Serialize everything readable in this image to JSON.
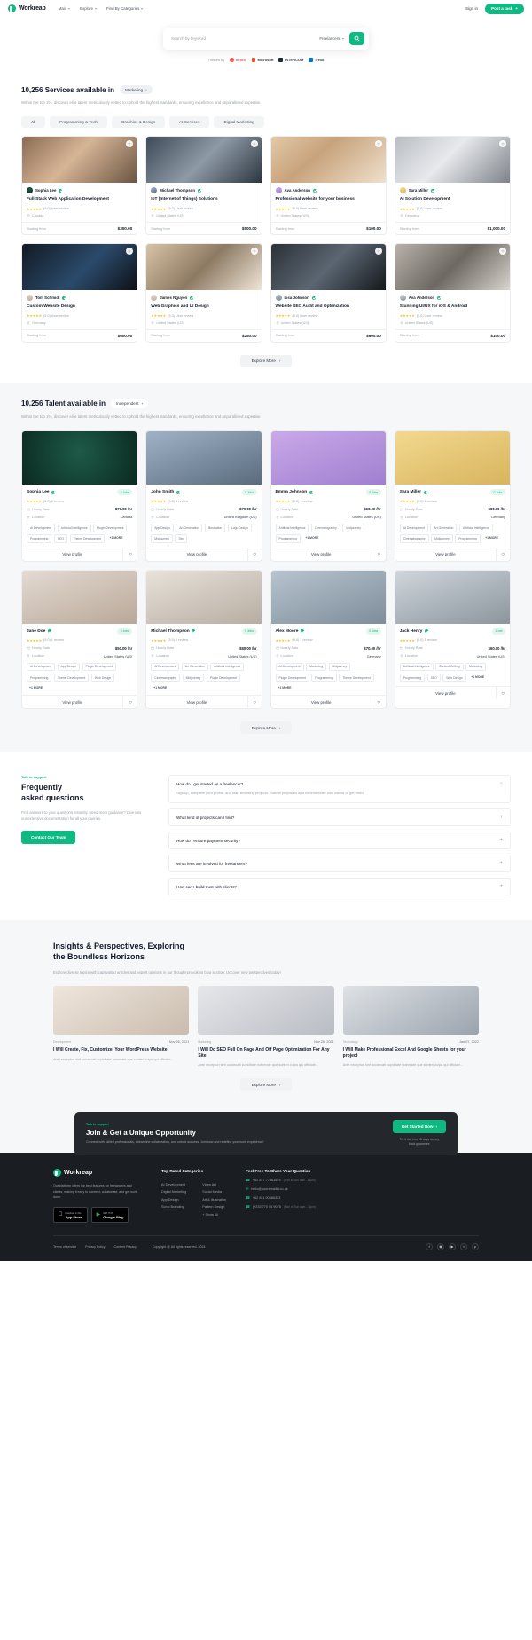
{
  "header": {
    "brand": "Workreap",
    "nav": [
      {
        "label": "Main",
        "caret": true
      },
      {
        "label": "Explore",
        "caret": true
      },
      {
        "label": "Find By Categories",
        "caret": true
      }
    ],
    "signin": "Sign in",
    "post_task": "Post a task",
    "post_task_icon": "plus-icon"
  },
  "hero": {
    "search_placeholder": "Search by keyword",
    "search_type": "Freelancers",
    "search_icon": "search-icon",
    "trusted_label": "Trusted by",
    "logos": [
      "airbnb",
      "Microsoft",
      "INTERCOM",
      "Trello"
    ]
  },
  "services": {
    "title": "10,256 Services available in",
    "tag": "Marketing",
    "subtitle": "Within the top 1%, discover elite talent meticulously vetted to uphold the highest standards, ensuring excellence and unparalleled expertise.",
    "tabs": [
      "All",
      "Programming & Tech",
      "Graphics & Design",
      "AI Services",
      "Digital Marketing"
    ],
    "active_tab": "All",
    "starting_from": "Starting from",
    "explore_more": "Explore More",
    "cards": [
      {
        "author": "Sophia Lee",
        "title": "Full-Stack Web Application Development",
        "rating": "5.00",
        "reviews": "(5.0) User review",
        "location": "Canada",
        "price": "$300.00",
        "img": "img-a",
        "avatar": "ph1"
      },
      {
        "author": "Michael Thompson",
        "title": "IoT (Internet of Things) Solutions",
        "rating": "5.00",
        "reviews": "(5.0) User review",
        "location": "United States (US)",
        "price": "$500.00",
        "img": "img-b",
        "avatar": "ph2"
      },
      {
        "author": "Ava Anderson",
        "title": "Professional website for your business",
        "rating": "5.00",
        "reviews": "(5.0) User review",
        "location": "United States (US)",
        "price": "$100.00",
        "img": "img-c",
        "avatar": "ph3"
      },
      {
        "author": "Sara Miller",
        "title": "AI Solution Development",
        "rating": "5.00",
        "reviews": "(5.0) User review",
        "location": "Germany",
        "price": "$1,000.00",
        "img": "img-d",
        "avatar": "ph4"
      },
      {
        "author": "Tom Schmidt",
        "title": "Custom Website Design",
        "rating": "5.00",
        "reviews": "(5.0) User review",
        "location": "Germany",
        "price": "$600.00",
        "img": "img-e",
        "avatar": "ph5"
      },
      {
        "author": "James Nguyen",
        "title": "Web Graphics and UI Design",
        "rating": "5.00",
        "reviews": "(5.0) User review",
        "location": "United States (US)",
        "price": "$250.00",
        "img": "img-f",
        "avatar": "ph6"
      },
      {
        "author": "Lisa Johnson",
        "title": "Website SEO Audit and Optimization",
        "rating": "5.00",
        "reviews": "(5.0) User review",
        "location": "United States (US)",
        "price": "$600.00",
        "img": "img-g",
        "avatar": "ph7"
      },
      {
        "author": "Ava Anderson",
        "title": "Stunning UI/UX for iOS & Android",
        "rating": "5.00",
        "reviews": "(5.0) User review",
        "location": "United States (US)",
        "price": "$100.00",
        "img": "img-h",
        "avatar": "ph8"
      }
    ]
  },
  "talent": {
    "title": "10,256 Talent available in",
    "tag": "Independent",
    "subtitle": "Within the top 1%, discover elite talent meticulously vetted to uphold the highest standards, ensuring excellence and unparalleled expertise.",
    "hourly_label": "Hourly Rate",
    "location_label": "Location",
    "view_profile": "View profile",
    "explore_more": "Explore More",
    "cards": [
      {
        "name": "Sophia Lee",
        "badge": "0 Jobs",
        "rating": "(5.0) 1 review",
        "rate": "$70.00 /hr",
        "location": "Canada",
        "img": "ph1",
        "tags": [
          "AI Development",
          "Artificial Intelligence",
          "Plugin Development",
          "Programming",
          "SEO",
          "Theme Development",
          "+1 MORE"
        ]
      },
      {
        "name": "John Smith",
        "badge": "0 Jobs",
        "rating": "(5.0) 1 review",
        "rate": "$70.00 /hr",
        "location": "United Kingdom (UK)",
        "img": "ph2",
        "tags": [
          "App Design",
          "Art Generation",
          "Illustration",
          "Logo Design",
          "Midjourney",
          "Seo"
        ]
      },
      {
        "name": "Emma Johnson",
        "badge": "0 Jobs",
        "rating": "(5.0) 1 review",
        "rate": "$60.00 /hr",
        "location": "United States (US)",
        "img": "ph3",
        "tags": [
          "Artificial Intelligence",
          "Cinematography",
          "Midjourney",
          "Programming",
          "+1 MORE"
        ]
      },
      {
        "name": "Sara Miller",
        "badge": "0 Jobs",
        "rating": "(5.0) 1 review",
        "rate": "$80.00 /hr",
        "location": "Germany",
        "img": "ph4",
        "tags": [
          "AI Development",
          "Art Generation",
          "Artificial Intelligence",
          "Cinematography",
          "Midjourney",
          "Programming",
          "+1 MORE"
        ]
      },
      {
        "name": "Jane Doe",
        "badge": "0 Jobs",
        "rating": "(5.0) 1 review",
        "rate": "$50.00 /hr",
        "location": "United States (US)",
        "img": "ph5",
        "tags": [
          "AI Development",
          "App Design",
          "Plugin Development",
          "Programming",
          "Theme Development",
          "Web Design",
          "+1 MORE"
        ]
      },
      {
        "name": "Michael Thompson",
        "badge": "0 Jobs",
        "rating": "(5.0) 1 review",
        "rate": "$80.00 /hr",
        "location": "United States (US)",
        "img": "ph6",
        "tags": [
          "AI Development",
          "Art Generation",
          "Artificial Intelligence",
          "Cinematography",
          "Midjourney",
          "Plugin Development",
          "+1 MORE"
        ]
      },
      {
        "name": "Alex Moore",
        "badge": "0 Jobs",
        "rating": "(5.0) 1 review",
        "rate": "$70.00 /hr",
        "location": "Germany",
        "img": "ph7",
        "tags": [
          "AI Development",
          "Marketing",
          "Midjourney",
          "Plugin Development",
          "Programming",
          "Theme Development",
          "+1 MORE"
        ]
      },
      {
        "name": "Jack Henry",
        "badge": "1 Job",
        "rating": "(5.0) 1 review",
        "rate": "$60.00 /hr",
        "location": "United States (US)",
        "img": "ph8",
        "tags": [
          "Artificial Intelligence",
          "Content Writing",
          "Marketing",
          "Programming",
          "SEO",
          "Web Design",
          "+1 MORE"
        ]
      }
    ]
  },
  "faq": {
    "kicker": "Talk to support",
    "heading_1": "Frequently",
    "heading_2": "asked questions",
    "paragraph": "Find answers to your questions instantly. Need more guidance? Dive into our extensive documentation for all your queries.",
    "button": "Contact Our Team",
    "items": [
      {
        "q": "How do I get started as a freelancer?",
        "a": "Sign up, complete your profile, and start browsing projects. Submit proposals and communicate with clients to get hired.",
        "open": true
      },
      {
        "q": "What kind of projects can I find?",
        "a": "",
        "open": false
      },
      {
        "q": "How do I ensure payment security?",
        "a": "",
        "open": false
      },
      {
        "q": "What fees are involved for freelancers?",
        "a": "",
        "open": false
      },
      {
        "q": "How can I build trust with clients?",
        "a": "",
        "open": false
      }
    ]
  },
  "blog": {
    "heading_1": "Insights & Perspectives, Exploring",
    "heading_2": "the Boundless Horizons",
    "paragraph": "Explore diverse topics with captivating articles and expert opinions in our thought-provoking blog section. Uncover new perspectives today!",
    "explore_more": "Explore More",
    "posts": [
      {
        "category": "Development",
        "date": "Nov 26, 2021",
        "title": "I Will Create, Fix, Customize, Your WordPress Website",
        "excerpt": "Ante excepturi sint occaecati cupiditate noinerate que sunten culpa qui officiale...",
        "img": "bl1"
      },
      {
        "category": "Marketing",
        "date": "Nov 26, 2021",
        "title": "I Will Do SEO Full On Page And Off Page Optimization For Any Site",
        "excerpt": "Ante excepturi sint occaecati cupiditate noinerate que sunten culpa qui officiale...",
        "img": "bl2"
      },
      {
        "category": "Technology",
        "date": "Jan 07, 2022",
        "title": "I Will Make Professional Excel And Google Sheets for your project",
        "excerpt": "Ante excepturi sint occaecati cupiditate noinerate que sunten culpa qui officiale...",
        "img": "bl3"
      }
    ]
  },
  "cta": {
    "kicker": "Talk to support",
    "heading": "Join & Get a Unique Opportunity",
    "paragraph": "Connect with skilled professionals, streamline collaboration, and unlock success. Join now and redefine your work experience!",
    "button": "Get Started Now",
    "note_1": "Try it risk free 15 days money",
    "note_2": "back guarantee"
  },
  "footer": {
    "brand": "Workreap",
    "about": "Our platform offers the best features for freelancers and clients, making it easy to connect, collaborate, and get work done.",
    "stores": [
      {
        "sub": "Download on the",
        "main": "App Store",
        "icon": "apple-icon"
      },
      {
        "sub": "GET IT ON",
        "main": "Google Play",
        "icon": "google-play-icon"
      }
    ],
    "categories_title": "Top Rated Categories",
    "categories_col1": [
      "AI Development",
      "Digital Marketing",
      "App Design",
      "Sonic Branding"
    ],
    "categories_col2": [
      "Video Art",
      "Social Media",
      "Art & Illustration",
      "Pattern Design",
      "+ Show All"
    ],
    "contact_title": "Feel Free To Share Your Question",
    "contacts": [
      {
        "icon": "phone-icon",
        "value": "+62 877 77363549",
        "note": "(Mon to Sun 8am - 11pm)"
      },
      {
        "icon": "mail-icon",
        "value": "hello@youremailid.co.uk",
        "note": ""
      },
      {
        "icon": "phone-icon",
        "value": "+62 811 00886353",
        "note": ""
      },
      {
        "icon": "phone-icon",
        "value": "(+233 770 55 9075",
        "note": "(Mon to Sun 8am - 11pm)"
      }
    ],
    "bottom_links": [
      "Terms of service",
      "Privacy Policy",
      "Content Privacy"
    ],
    "copyright": "Copyright @ All rights reserved. 2024",
    "socials": [
      "facebook-icon",
      "instagram-icon",
      "youtube-icon",
      "twitter-icon",
      "pinterest-icon"
    ]
  }
}
